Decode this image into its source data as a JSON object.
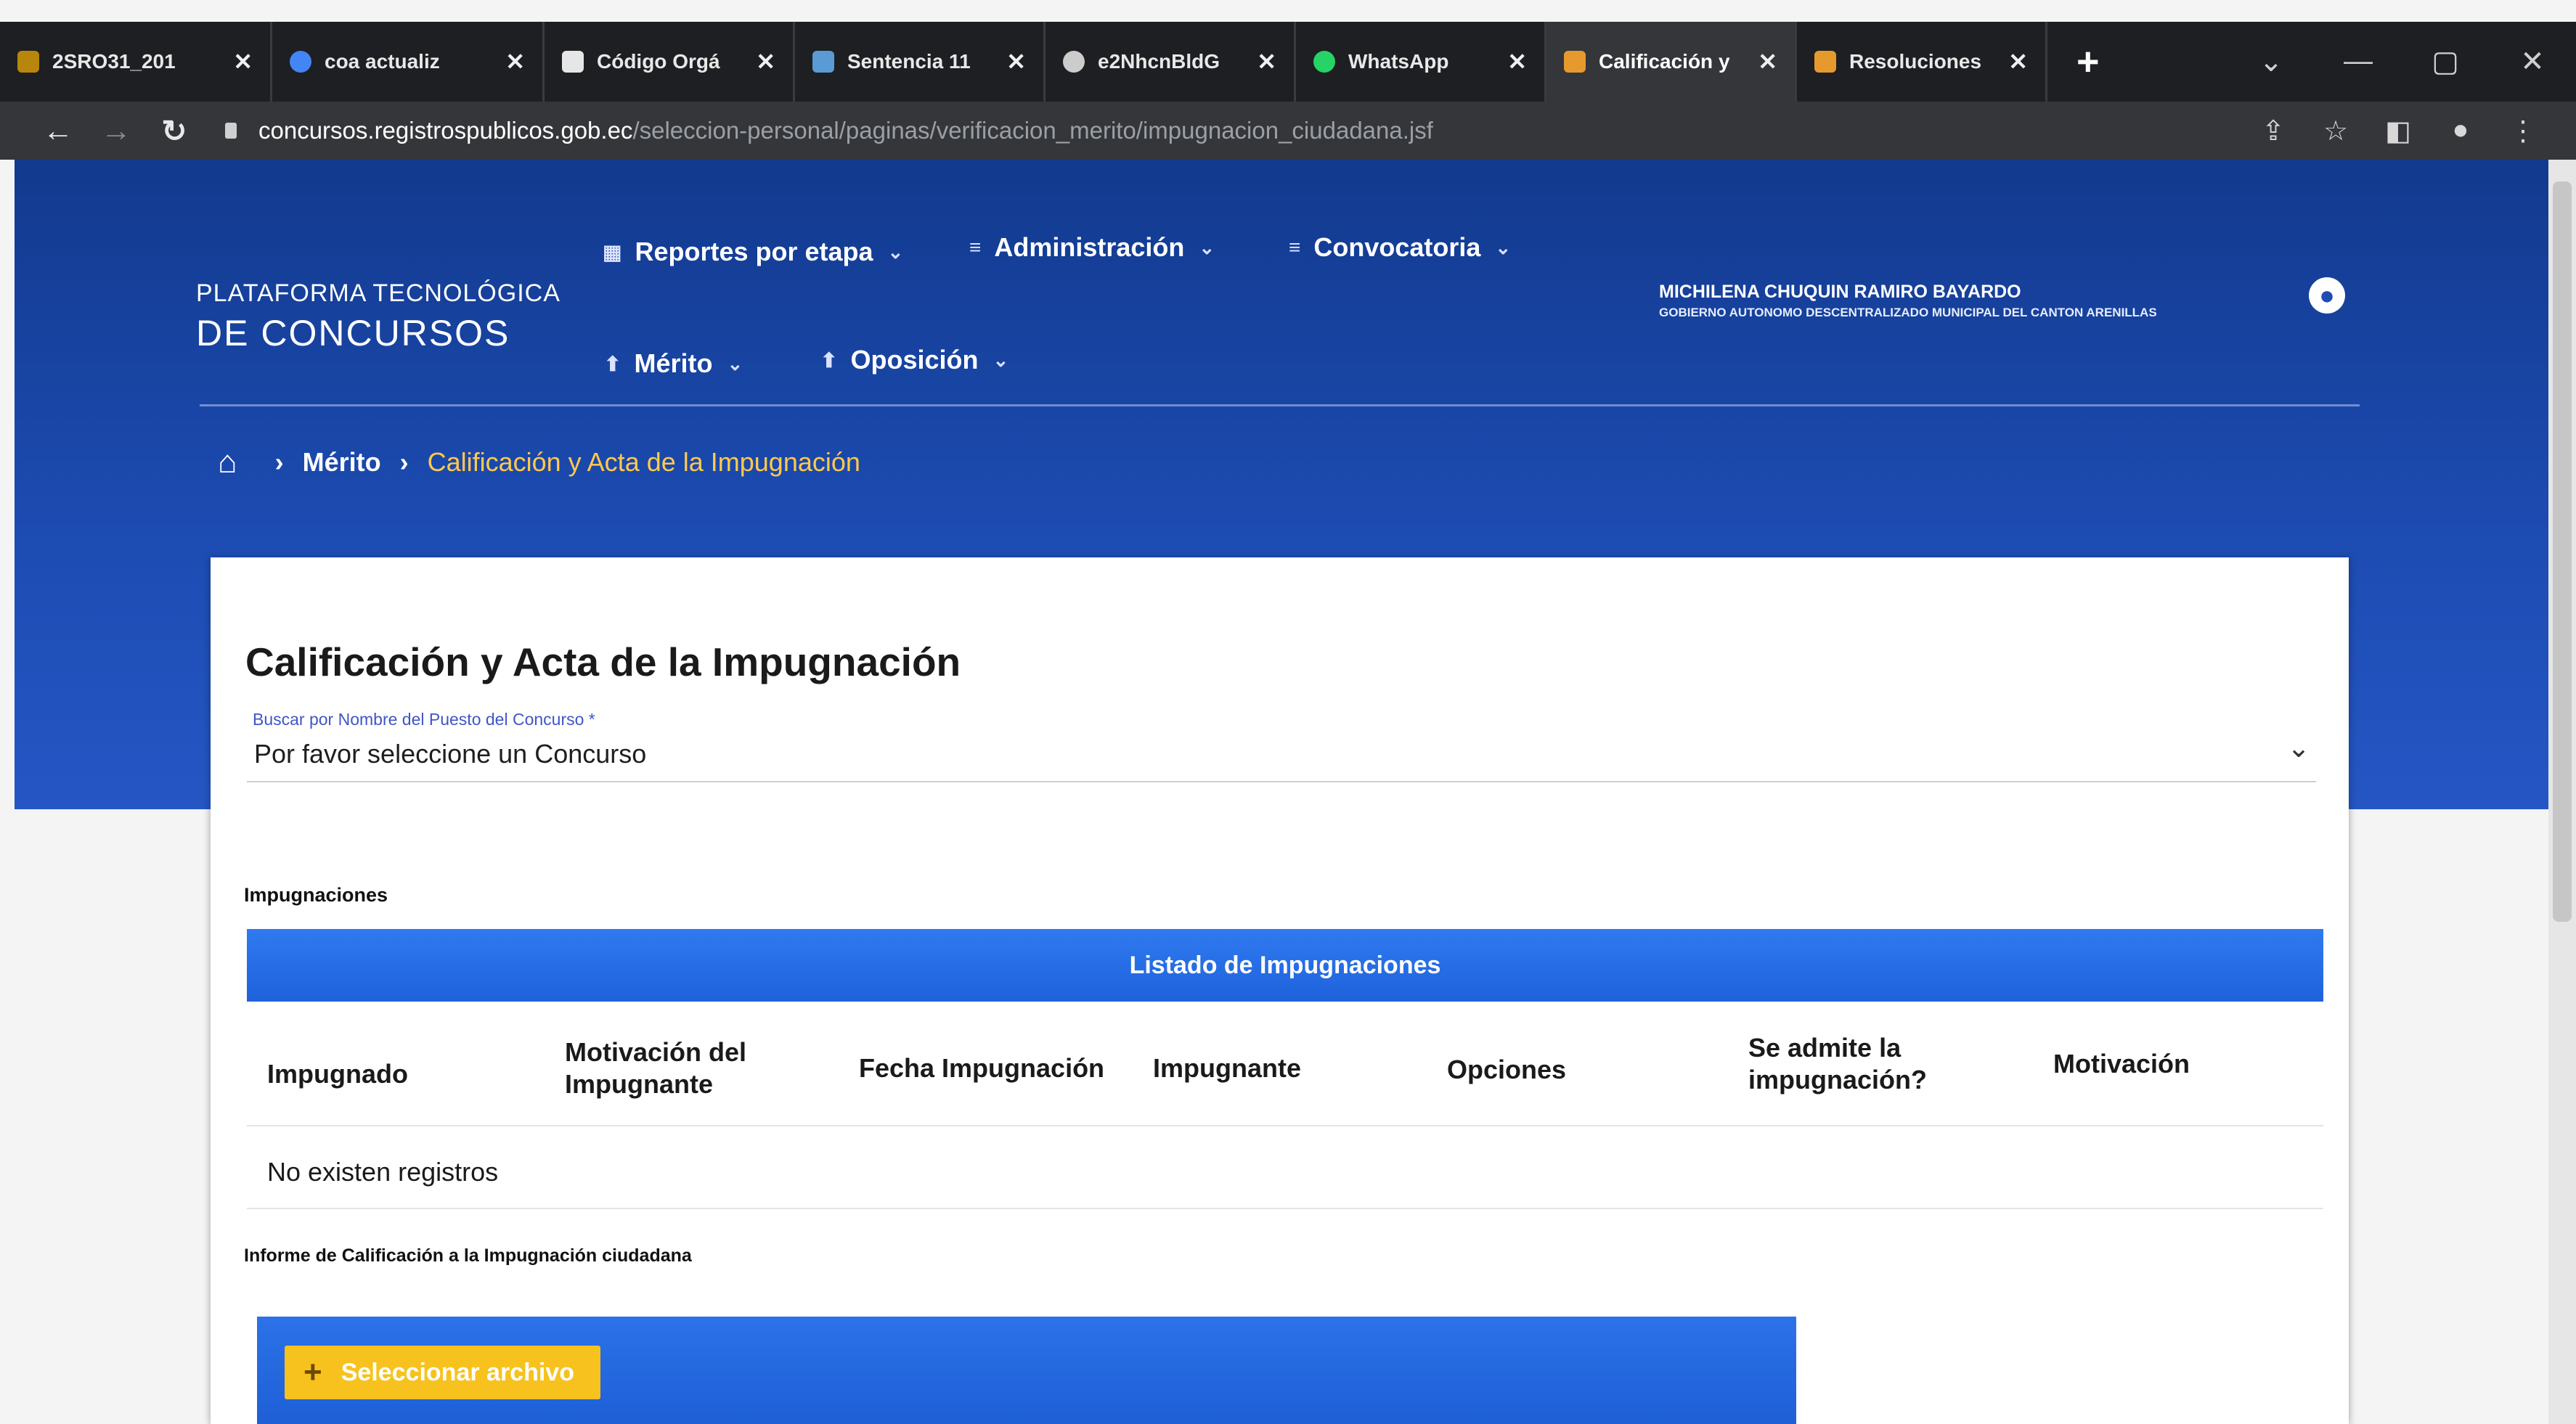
{
  "browser": {
    "tabs": [
      {
        "title": "2SRO31_201",
        "favicon_color": "#b8860b",
        "active": false
      },
      {
        "title": "coa actualiz",
        "favicon_color": "#4285f4",
        "active": false
      },
      {
        "title": "Código Orgá",
        "favicon_color": "#e6e6e6",
        "active": false
      },
      {
        "title": "Sentencia 11",
        "favicon_color": "#5b9bd5",
        "active": false
      },
      {
        "title": "e2NhcnBldG",
        "favicon_color": "#cccccc",
        "active": false
      },
      {
        "title": "WhatsApp",
        "favicon_color": "#25d366",
        "active": false
      },
      {
        "title": "Calificación y",
        "favicon_color": "#e69a2e",
        "active": true
      },
      {
        "title": "Resoluciones",
        "favicon_color": "#e69a2e",
        "active": false
      }
    ],
    "url_host": "concursos.registrospublicos.gob.ec",
    "url_path": "/seleccion-personal/paginas/verificacion_merito/impugnacion_ciudadana.jsf"
  },
  "header": {
    "brand_top": "PLATAFORMA TECNOLÓGICA",
    "brand_bottom": "DE CONCURSOS",
    "menu": {
      "reportes": "Reportes por etapa",
      "administracion": "Administración",
      "convocatoria": "Convocatoria",
      "merito": "Mérito",
      "oposicion": "Oposición"
    },
    "user_name": "MICHILENA CHUQUIN RAMIRO BAYARDO",
    "user_org": "GOBIERNO AUTONOMO DESCENTRALIZADO MUNICIPAL DEL CANTON ARENILLAS"
  },
  "breadcrumb": {
    "level1": "Mérito",
    "current": "Calificación y Acta de la Impugnación"
  },
  "main": {
    "title": "Calificación y Acta de la Impugnación",
    "search_label": "Buscar por Nombre del Puesto del Concurso *",
    "search_value": "Por favor seleccione un Concurso",
    "impugnaciones_section": "Impugnaciones",
    "table_title": "Listado de Impugnaciones",
    "columns": [
      "Impugnado",
      "Motivación del Impugnante",
      "Fecha Impugnación",
      "Impugnante",
      "Opciones",
      "Se admite la impugnación?",
      "Motivación"
    ],
    "empty_message": "No existen registros",
    "report_section": "Informe de Calificación a la Impugnación ciudadana",
    "upload_label": "Seleccionar archivo"
  },
  "colors": {
    "header_bg": "#1d4cb3",
    "table_header": "#2f7af0",
    "upload_button": "#f7c21e",
    "breadcrumb_current": "#ffc94d"
  }
}
